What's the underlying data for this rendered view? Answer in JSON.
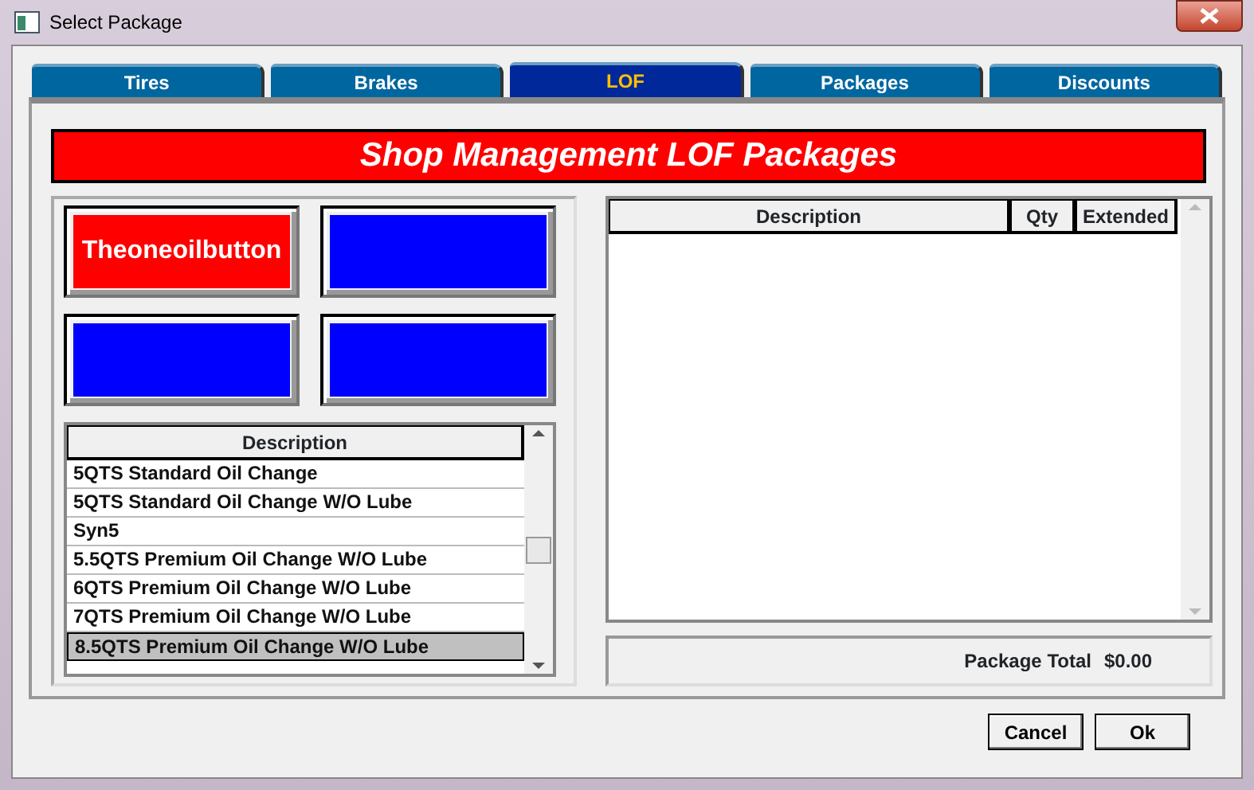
{
  "window": {
    "title": "Select Package"
  },
  "tabs": [
    {
      "label": "Tires",
      "selected": false
    },
    {
      "label": "Brakes",
      "selected": false
    },
    {
      "label": "LOF",
      "selected": true
    },
    {
      "label": "Packages",
      "selected": false
    },
    {
      "label": "Discounts",
      "selected": false
    }
  ],
  "banner": "Shop Management LOF Packages",
  "package_buttons": [
    {
      "label": "Theoneoilbutton",
      "color": "#ff0000"
    },
    {
      "color": "#0000ff"
    },
    {
      "color": "#0000ff"
    },
    {
      "color": "#0000ff"
    }
  ],
  "package_list": {
    "columns": [
      "Description"
    ],
    "rows": [
      {
        "description": "5QTS Standard Oil Change",
        "selected": false
      },
      {
        "description": "5QTS Standard Oil Change W/O Lube",
        "selected": false
      },
      {
        "description": "Syn5",
        "selected": false
      },
      {
        "description": "5.5QTS Premium Oil Change W/O Lube",
        "selected": false
      },
      {
        "description": "6QTS Premium Oil Change W/O Lube",
        "selected": false
      },
      {
        "description": "7QTS Premium Oil Change W/O Lube",
        "selected": false
      },
      {
        "description": "8.5QTS Premium Oil Change W/O Lube",
        "selected": true
      }
    ]
  },
  "items_table": {
    "columns": [
      "Description",
      "Qty",
      "Extended"
    ]
  },
  "total": {
    "label": "Package Total",
    "value": "$0.00"
  },
  "buttons": [
    "Cancel",
    "Ok"
  ]
}
